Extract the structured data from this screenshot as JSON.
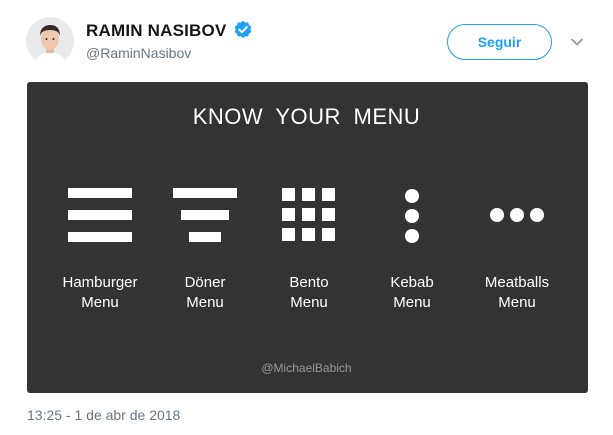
{
  "author": {
    "name": "RAMIN NASIBOV",
    "handle": "@RaminNasibov",
    "verified": true
  },
  "follow_label": "Seguir",
  "colors": {
    "accent": "#1da1f2",
    "card_background": "#333333",
    "secondary_text": "#657786"
  },
  "media": {
    "title": "KNOW YOUR MENU",
    "menus": [
      {
        "line1": "Hamburger",
        "line2": "Menu",
        "icon": "hamburger-menu-icon"
      },
      {
        "line1": "Döner",
        "line2": "Menu",
        "icon": "doner-menu-icon"
      },
      {
        "line1": "Bento",
        "line2": "Menu",
        "icon": "bento-menu-icon"
      },
      {
        "line1": "Kebab",
        "line2": "Menu",
        "icon": "kebab-menu-icon"
      },
      {
        "line1": "Meatballs",
        "line2": "Menu",
        "icon": "meatballs-menu-icon"
      }
    ],
    "credit": "@MichaelBabich"
  },
  "timestamp": "13:25 - 1 de abr de 2018"
}
